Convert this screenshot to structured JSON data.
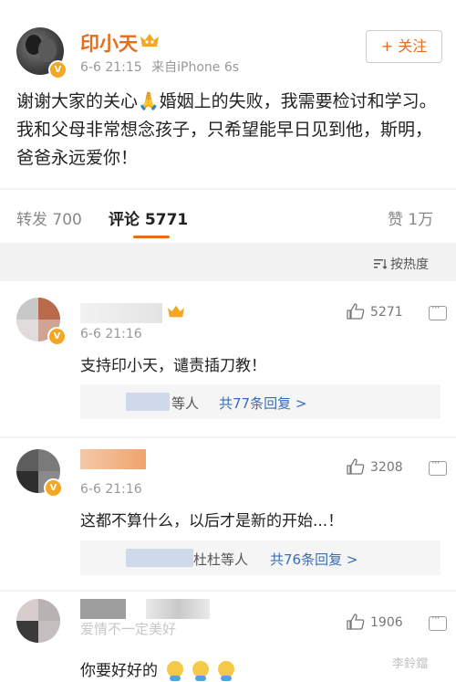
{
  "post": {
    "username": "印小天",
    "date": "6-6 21:15",
    "source": "来自iPhone 6s",
    "follow_label": "+ 关注",
    "text": "谢谢大家的关心🙏婚姻上的失败，我需要检讨和学习。我和父母非常想念孩子，只希望能早日见到他，斯明，爸爸永远爱你！"
  },
  "tabs": {
    "repost": "转发 700",
    "comment": "评论 5771",
    "like": "赞 1万"
  },
  "sort": {
    "label": "按热度"
  },
  "comments": [
    {
      "time": "6-6 21:16",
      "text": "支持印小天，谴责插刀教！",
      "likes": "5271",
      "reply_suffix": "等人",
      "reply_link": "共77条回复 >"
    },
    {
      "time": "6-6 21:16",
      "text": "这都不算什么，以后才是新的开始...！",
      "likes": "3208",
      "reply_suffix": "杜杜等人",
      "reply_link": "共76条回复 >"
    },
    {
      "time": "",
      "text": "你要好好的",
      "likes": "1906"
    }
  ],
  "partial_name_3": "爱情不一定美好",
  "watermark": "李鈴鐺",
  "colors": {
    "accent": "#e86c1a",
    "link": "#3b6cb7",
    "badge": "#f5a623"
  }
}
